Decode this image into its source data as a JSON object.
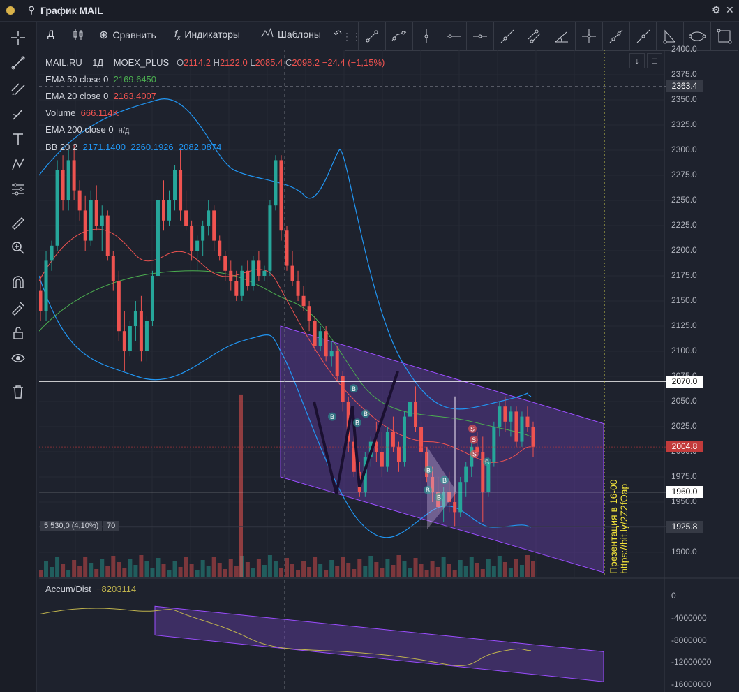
{
  "window": {
    "title": "График MAIL",
    "settings_icon": "gear-icon",
    "close_icon": "close-icon"
  },
  "toolbar": {
    "interval": "Д",
    "compare": "Сравнить",
    "indicators": "Индикаторы",
    "templates": "Шаблоны",
    "undo_icon": "undo-icon"
  },
  "drawing_tools": [
    "trend-line-icon",
    "ray-icon",
    "vertical-line-icon",
    "horizontal-line-icon",
    "horizontal-ray-icon",
    "extended-line-icon",
    "parallel-channel-icon",
    "pitchfork-icon",
    "crosshair-icon",
    "info-line-icon",
    "arrow-line-icon",
    "triangle-icon",
    "ellipse-icon",
    "rectangle-icon"
  ],
  "left_tools": [
    "crosshair-icon",
    "trend-line-icon",
    "fib-icon",
    "brush-icon",
    "text-icon",
    "pattern-icon",
    "measure-lines-icon",
    "ruler-icon",
    "zoom-icon",
    "magnet-icon",
    "lock-drawing-icon",
    "unlock-icon",
    "eye-icon",
    "trash-icon"
  ],
  "legend": {
    "symbol": "MAIL.RU",
    "tf": "1Д",
    "exchange": "MOEX_PLUS",
    "o_label": "O",
    "o": "2114.2",
    "h_label": "H",
    "h": "2122.0",
    "l_label": "L",
    "l": "2085.4",
    "c_label": "C",
    "c": "2098.2",
    "change": "−24.4 (−1,15%)",
    "ema50_label": "EMA 50 close 0",
    "ema50": "2169.6450",
    "ema20_label": "EMA 20 close 0",
    "ema20": "2163.4007",
    "volume_label": "Volume",
    "volume": "666.114K",
    "ema200_label": "EMA 200 close 0",
    "ema200": "н/д",
    "bb_label": "BB 20 2",
    "bb_basis": "2171.1400",
    "bb_upper": "2260.1926",
    "bb_lower": "2082.0874"
  },
  "price_axis": [
    "2400.0",
    "2375.0",
    "2350.0",
    "2325.0",
    "2300.0",
    "2275.0",
    "2250.0",
    "2225.0",
    "2200.0",
    "2175.0",
    "2150.0",
    "2125.0",
    "2100.0",
    "2075.0",
    "2050.0",
    "2025.0",
    "2000.0",
    "1975.0",
    "1950.0",
    "1925.0",
    "1900.0"
  ],
  "price_tags": {
    "crosshair": "2363.4",
    "line_high": "2070.0",
    "last": "2004.8",
    "line_low": "1960.0",
    "measure": "1925.8"
  },
  "measure": {
    "range": "5 530,0 (4,10%)",
    "bars": "70"
  },
  "signals": [
    "B",
    "B",
    "B",
    "B",
    "B",
    "B",
    "S",
    "S",
    "S",
    "B",
    "B",
    "B"
  ],
  "promo": {
    "line1": "Презентация в 16-00",
    "line2": "https://bit.ly/2Z2fOap"
  },
  "accum": {
    "label": "Accum/Dist",
    "value": "−8203114",
    "axis": [
      "0",
      "-4000000",
      "-8000000",
      "-12000000",
      "-16000000"
    ]
  },
  "chart_data": {
    "type": "candlestick",
    "title": "MAIL.RU · 1Д · MOEX_PLUS",
    "ylim": [
      1880,
      2400
    ],
    "candles": [
      [
        2160,
        2175,
        2130,
        2140
      ],
      [
        2140,
        2200,
        2130,
        2190
      ],
      [
        2190,
        2210,
        2180,
        2205
      ],
      [
        2205,
        2290,
        2200,
        2280
      ],
      [
        2280,
        2295,
        2240,
        2250
      ],
      [
        2250,
        2300,
        2240,
        2290
      ],
      [
        2290,
        2305,
        2250,
        2260
      ],
      [
        2260,
        2270,
        2230,
        2240
      ],
      [
        2240,
        2255,
        2200,
        2210
      ],
      [
        2210,
        2260,
        2205,
        2250
      ],
      [
        2250,
        2265,
        2220,
        2225
      ],
      [
        2225,
        2245,
        2200,
        2235
      ],
      [
        2235,
        2240,
        2190,
        2195
      ],
      [
        2195,
        2200,
        2160,
        2170
      ],
      [
        2170,
        2180,
        2110,
        2120
      ],
      [
        2120,
        2140,
        2080,
        2100
      ],
      [
        2100,
        2130,
        2095,
        2125
      ],
      [
        2125,
        2150,
        2110,
        2140
      ],
      [
        2140,
        2155,
        2090,
        2100
      ],
      [
        2100,
        2135,
        2090,
        2130
      ],
      [
        2130,
        2180,
        2125,
        2175
      ],
      [
        2175,
        2255,
        2170,
        2250
      ],
      [
        2250,
        2270,
        2220,
        2230
      ],
      [
        2230,
        2260,
        2225,
        2250
      ],
      [
        2250,
        2285,
        2240,
        2280
      ],
      [
        2280,
        2300,
        2230,
        2240
      ],
      [
        2240,
        2260,
        2220,
        2225
      ],
      [
        2225,
        2230,
        2190,
        2200
      ],
      [
        2200,
        2215,
        2180,
        2210
      ],
      [
        2210,
        2230,
        2195,
        2225
      ],
      [
        2225,
        2250,
        2215,
        2240
      ],
      [
        2240,
        2245,
        2200,
        2210
      ],
      [
        2210,
        2215,
        2190,
        2195
      ],
      [
        2195,
        2200,
        2170,
        2180
      ],
      [
        2180,
        2190,
        2160,
        2170
      ],
      [
        2170,
        2180,
        2150,
        2155
      ],
      [
        2155,
        2185,
        2150,
        2180
      ],
      [
        2180,
        2190,
        2160,
        2165
      ],
      [
        2165,
        2195,
        2160,
        2190
      ],
      [
        2190,
        2200,
        2170,
        2175
      ],
      [
        2175,
        2185,
        2170,
        2180
      ],
      [
        2180,
        2250,
        2175,
        2245
      ],
      [
        2245,
        2295,
        2240,
        2290
      ],
      [
        2290,
        2295,
        2210,
        2220
      ],
      [
        2220,
        2225,
        2180,
        2185
      ],
      [
        2185,
        2200,
        2165,
        2170
      ],
      [
        2170,
        2180,
        2150,
        2155
      ],
      [
        2155,
        2165,
        2140,
        2145
      ],
      [
        2145,
        2150,
        2120,
        2130
      ],
      [
        2130,
        2135,
        2100,
        2105
      ],
      [
        2105,
        2125,
        2100,
        2120
      ],
      [
        2120,
        2125,
        2090,
        2095
      ],
      [
        2095,
        2110,
        2085,
        2100
      ],
      [
        2100,
        2105,
        2070,
        2075
      ],
      [
        2075,
        2080,
        2040,
        2050
      ],
      [
        2050,
        2055,
        2000,
        2010
      ],
      [
        2010,
        2030,
        1975,
        1980
      ],
      [
        1980,
        1990,
        1955,
        1960
      ],
      [
        1960,
        2000,
        1955,
        1995
      ],
      [
        1995,
        2015,
        1985,
        2010
      ],
      [
        2010,
        2030,
        1990,
        2000
      ],
      [
        2000,
        2020,
        1975,
        1985
      ],
      [
        1985,
        2025,
        1980,
        2020
      ],
      [
        2020,
        2035,
        2000,
        2005
      ],
      [
        2005,
        2010,
        1980,
        1990
      ],
      [
        1990,
        2040,
        1985,
        2035
      ],
      [
        2035,
        2060,
        2020,
        2050
      ],
      [
        2050,
        2065,
        2020,
        2025
      ],
      [
        2025,
        2030,
        1995,
        2000
      ],
      [
        2000,
        2005,
        1970,
        1975
      ],
      [
        1975,
        1985,
        1950,
        1960
      ],
      [
        1960,
        1975,
        1940,
        1945
      ],
      [
        1945,
        1965,
        1930,
        1960
      ],
      [
        1960,
        1980,
        1940,
        1950
      ],
      [
        1950,
        1965,
        1925,
        1940
      ],
      [
        1940,
        1975,
        1935,
        1970
      ],
      [
        1970,
        1990,
        1955,
        1985
      ],
      [
        1985,
        2010,
        1975,
        2005
      ],
      [
        2005,
        2020,
        1995,
        2000
      ],
      [
        2000,
        2015,
        1930,
        1960
      ],
      [
        1960,
        1995,
        1955,
        1990
      ],
      [
        1990,
        2030,
        1985,
        2025
      ],
      [
        2025,
        2050,
        2015,
        2045
      ],
      [
        2045,
        2055,
        2020,
        2030
      ],
      [
        2030,
        2045,
        2015,
        2040
      ],
      [
        2040,
        2045,
        2005,
        2010
      ],
      [
        2010,
        2040,
        2005,
        2035
      ],
      [
        2035,
        2045,
        2020,
        2025
      ],
      [
        2025,
        2030,
        1995,
        2005
      ]
    ]
  }
}
